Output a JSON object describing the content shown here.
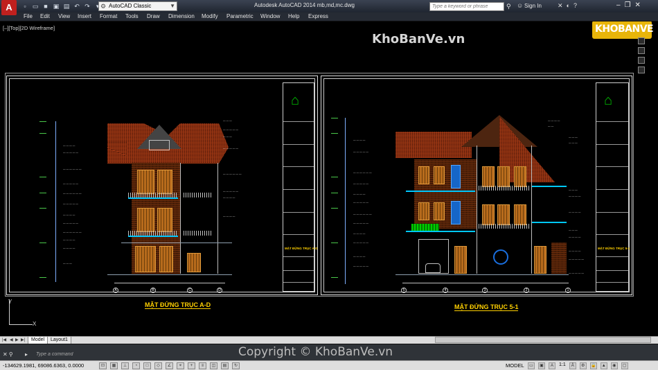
{
  "window": {
    "app_logo": "A",
    "title": "Autodesk AutoCAD 2014    mb,md,mc.dwg",
    "workspace": "AutoCAD Classic",
    "search_placeholder": "Type a keyword or phrase",
    "sign_in": "Sign In"
  },
  "menu": [
    "File",
    "Edit",
    "View",
    "Insert",
    "Format",
    "Tools",
    "Draw",
    "Dimension",
    "Modify",
    "Parametric",
    "Window",
    "Help",
    "Express"
  ],
  "viewport": {
    "label": "[–][Top][2D Wireframe]"
  },
  "watermarks": {
    "top": "KhoBanVe.vn",
    "logo": "KHOBANVE",
    "bottom": "Copyright © KhoBanVe.vn"
  },
  "drawings": {
    "left_title": "MẶT ĐỨNG TRỤC A-D",
    "right_title": "MẶT ĐỨNG TRỤC 5-1",
    "left_grid": [
      "A",
      "B",
      "C",
      "D"
    ],
    "right_grid": [
      "5",
      "4",
      "3",
      "2",
      "1"
    ],
    "left_tb_caption": "MẶT ĐỨNG TRỤC A-D",
    "right_tb_caption": "MẶT ĐỨNG TRỤC 5-1"
  },
  "ucs": {
    "x": "X",
    "y": "Y"
  },
  "tabs": {
    "model": "Model",
    "layout1": "Layout1"
  },
  "command": {
    "placeholder": "Type a command"
  },
  "status": {
    "coords": "-134629.1981, 69086.6363, 0.0000",
    "model": "MODEL",
    "scale": "1:1"
  }
}
